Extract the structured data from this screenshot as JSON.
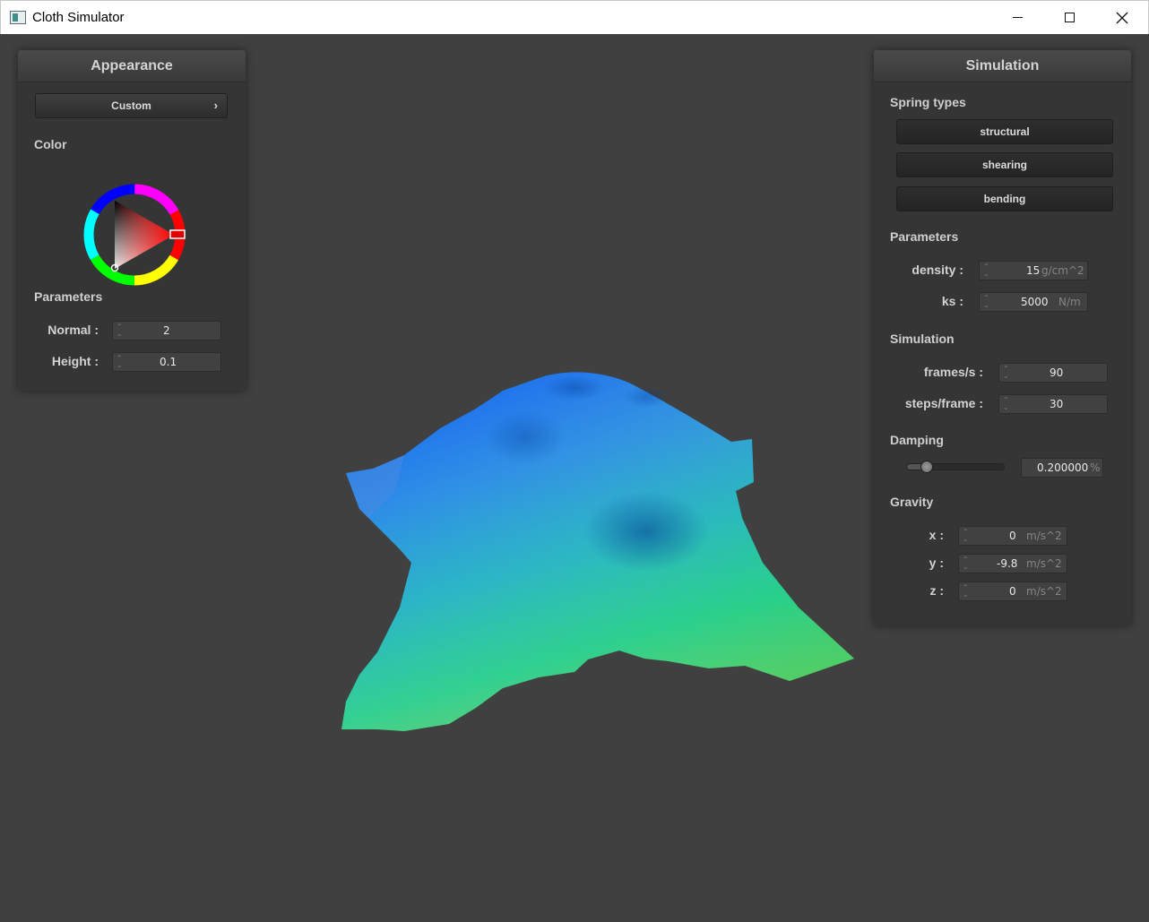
{
  "window": {
    "title": "Cloth Simulator"
  },
  "appearance": {
    "header": "Appearance",
    "shader_select": "Custom",
    "shader_select_arrow": "›",
    "color_label": "Color",
    "selected_color": "#e00000",
    "parameters_label": "Parameters",
    "normal_label": "Normal :",
    "normal_value": "2",
    "height_label": "Height :",
    "height_value": "0.1"
  },
  "simulation": {
    "header": "Simulation",
    "spring_types_label": "Spring types",
    "spring_buttons": [
      "structural",
      "shearing",
      "bending"
    ],
    "parameters_label": "Parameters",
    "density_label": "density :",
    "density_value": "15",
    "density_unit": "g/cm^2",
    "ks_label": "ks :",
    "ks_value": "5000",
    "ks_unit": "N/m",
    "sim_label": "Simulation",
    "fps_label": "frames/s :",
    "fps_value": "90",
    "steps_label": "steps/frame :",
    "steps_value": "30",
    "damping_label": "Damping",
    "damping_value": "0.200000",
    "damping_unit": "%",
    "damping_level": 0.2,
    "gravity_label": "Gravity",
    "gx_label": "x :",
    "gx_value": "0",
    "gy_label": "y :",
    "gy_value": "-9.8",
    "gz_label": "z :",
    "gz_value": "0",
    "gravity_unit": "m/s^2"
  },
  "spinner_glyph": "⌃⌄"
}
